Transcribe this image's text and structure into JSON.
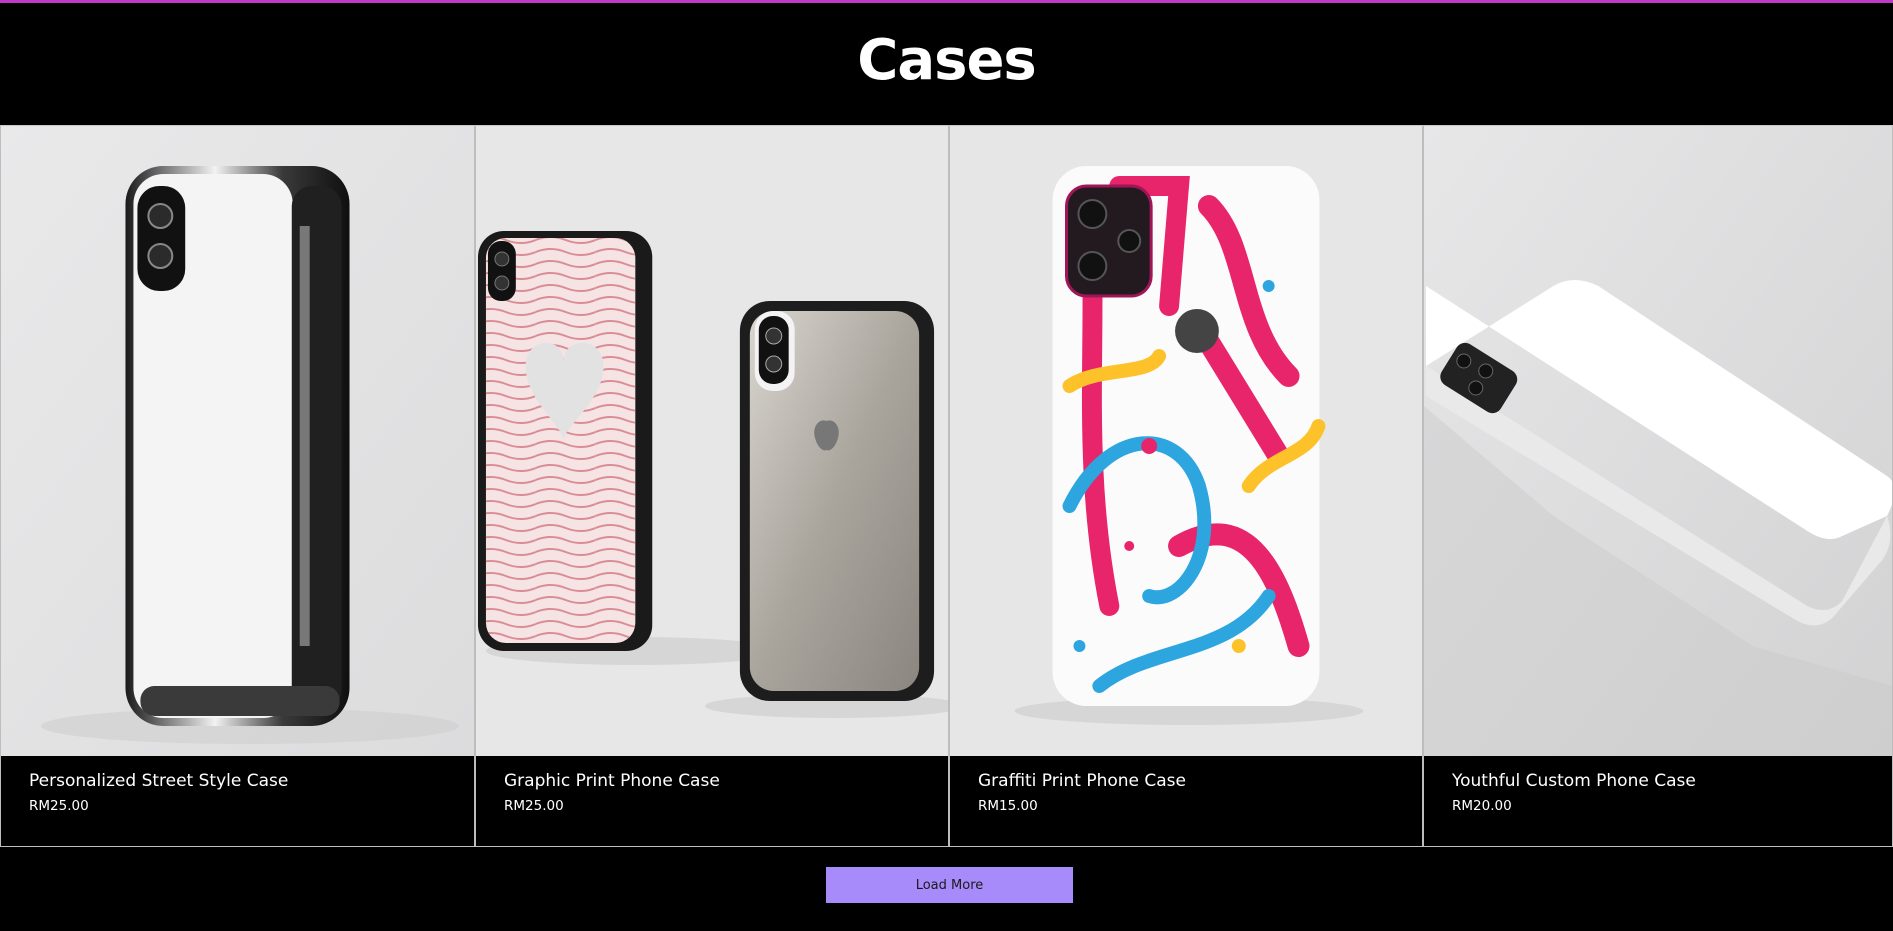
{
  "page": {
    "title": "Cases"
  },
  "products": [
    {
      "name": "Personalized Street Style Case",
      "price": "RM25.00",
      "image_icon": "chrome-phone-case-image"
    },
    {
      "name": "Graphic Print Phone Case",
      "price": "RM25.00",
      "image_icon": "heart-print-phone-case-image"
    },
    {
      "name": "Graffiti Print Phone Case",
      "price": "RM15.00",
      "image_icon": "graffiti-phone-case-image"
    },
    {
      "name": "Youthful Custom Phone Case",
      "price": "RM20.00",
      "image_icon": "white-phone-case-image"
    }
  ],
  "load_more": {
    "label": "Load More"
  },
  "colors": {
    "accent_bar": "#c03ac9",
    "button_bg": "#a78bfa",
    "background": "#000000"
  }
}
